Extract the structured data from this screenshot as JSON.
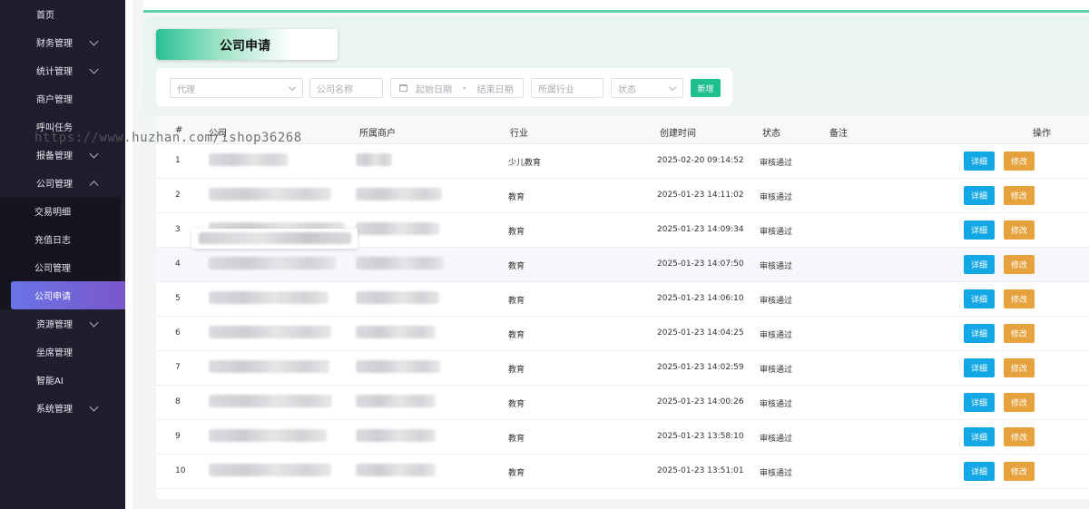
{
  "sidebar": {
    "items": [
      {
        "label": "首页",
        "expandable": false
      },
      {
        "label": "财务管理",
        "expandable": true
      },
      {
        "label": "统计管理",
        "expandable": true
      },
      {
        "label": "商户管理",
        "expandable": false
      },
      {
        "label": "呼叫任务",
        "expandable": false
      },
      {
        "label": "报备管理",
        "expandable": true
      },
      {
        "label": "公司管理",
        "expandable": true,
        "expanded": true
      }
    ],
    "submenu": [
      {
        "label": "交易明细"
      },
      {
        "label": "充值日志"
      },
      {
        "label": "公司管理"
      },
      {
        "label": "公司申请",
        "active": true
      }
    ],
    "items_after": [
      {
        "label": "资源管理",
        "expandable": true
      },
      {
        "label": "坐席管理",
        "expandable": false
      },
      {
        "label": "智能AI",
        "expandable": false
      },
      {
        "label": "系统管理",
        "expandable": true
      }
    ]
  },
  "page": {
    "title": "公司申请"
  },
  "filters": {
    "agent_placeholder": "代理",
    "company_placeholder": "公司名称",
    "start_date_placeholder": "起始日期",
    "range_separator": "-",
    "end_date_placeholder": "结束日期",
    "industry_placeholder": "所属行业",
    "status_placeholder": "状态",
    "new_button": "新增"
  },
  "table": {
    "columns": [
      "#",
      "公司",
      "所属商户",
      "行业",
      "创建时间",
      "状态",
      "备注",
      "操作"
    ],
    "rows": [
      {
        "index": "1",
        "industry": "少儿教育",
        "created": "2025-02-20 09:14:52",
        "status": "审核通过"
      },
      {
        "index": "2",
        "industry": "教育",
        "created": "2025-01-23 14:11:02",
        "status": "审核通过"
      },
      {
        "index": "3",
        "industry": "教育",
        "created": "2025-01-23 14:09:34",
        "status": "审核通过"
      },
      {
        "index": "4",
        "industry": "教育",
        "created": "2025-01-23 14:07:50",
        "status": "审核通过"
      },
      {
        "index": "5",
        "industry": "教育",
        "created": "2025-01-23 14:06:10",
        "status": "审核通过"
      },
      {
        "index": "6",
        "industry": "教育",
        "created": "2025-01-23 14:04:25",
        "status": "审核通过"
      },
      {
        "index": "7",
        "industry": "教育",
        "created": "2025-01-23 14:02:59",
        "status": "审核通过"
      },
      {
        "index": "8",
        "industry": "教育",
        "created": "2025-01-23 14:00:26",
        "status": "审核通过"
      },
      {
        "index": "9",
        "industry": "教育",
        "created": "2025-01-23 13:58:10",
        "status": "审核通过"
      },
      {
        "index": "10",
        "industry": "教育",
        "created": "2025-01-23 13:51:01",
        "status": "审核通过"
      }
    ],
    "detail_label": "详细",
    "edit_label": "修改"
  },
  "watermark": "https://www.huzhan.com/ishop36268",
  "colors": {
    "sidebar_bg": "#1f1e2f",
    "active_menu": "#6a74e6",
    "accent_green": "#1fbf8f",
    "detail_btn": "#14a7e6",
    "edit_btn": "#e6a23c"
  }
}
